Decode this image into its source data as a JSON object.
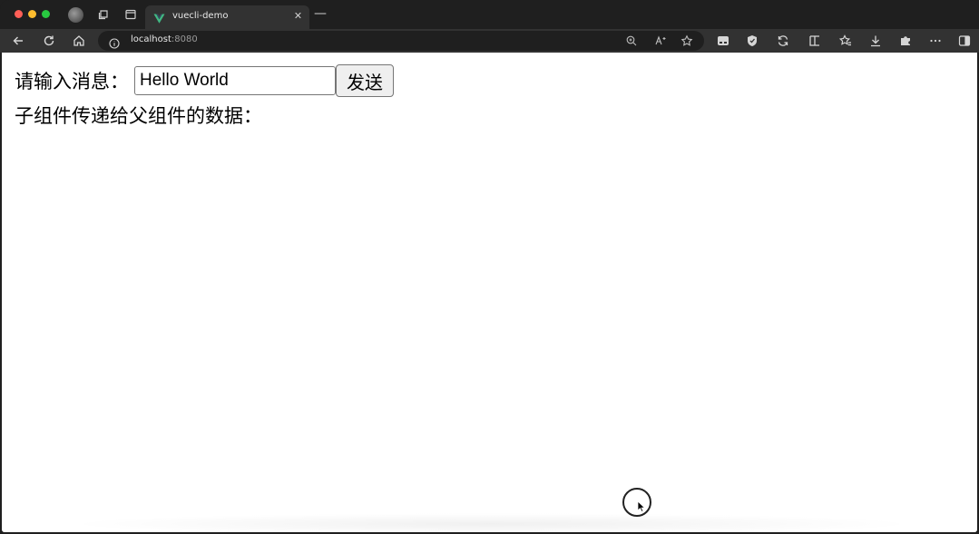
{
  "browser": {
    "tab": {
      "title": "vuecli-demo",
      "favicon": "vue-logo-icon"
    },
    "address": {
      "host": "localhost",
      "port": ":8080"
    },
    "nav_icons": [
      "back-arrow-icon",
      "reload-icon",
      "home-icon",
      "info-icon"
    ],
    "toolbar_icons": [
      "zoom-icon",
      "read-aloud-icon",
      "favorite-star-icon",
      "extension-icon",
      "shield-icon",
      "sync-icon",
      "split-screen-icon",
      "favorites-icon",
      "download-icon",
      "extensions-puzzle-icon",
      "more-icon",
      "sidebar-icon"
    ]
  },
  "page": {
    "input_label": "请输入消息：",
    "input_value": "Hello World",
    "send_label": "发送",
    "child_data_label": "子组件传递给父组件的数据："
  },
  "colors": {
    "chrome_dark": "#1f1f1f",
    "toolbar": "#323232",
    "vue_green": "#41b883",
    "vue_dark": "#35495e"
  }
}
